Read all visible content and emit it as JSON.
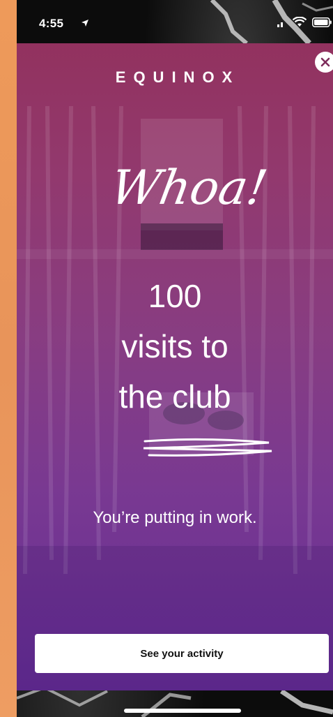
{
  "status_bar": {
    "time": "4:55",
    "icons": [
      "location-arrow-icon",
      "signal-icon",
      "wifi-icon",
      "battery-icon"
    ]
  },
  "modal": {
    "brand": "EQUINOX",
    "close_icon": "close-icon",
    "script_heading": "Whoa!",
    "headline": [
      "100",
      "visits to",
      "the club"
    ],
    "subtext": "You’re putting in work.",
    "cta_label": "See your activity"
  },
  "colors": {
    "gradient_top": "#96305a",
    "gradient_bottom": "#622a96",
    "side_strip": "#ee9a5a",
    "button_bg": "#ffffff",
    "text": "#ffffff"
  }
}
